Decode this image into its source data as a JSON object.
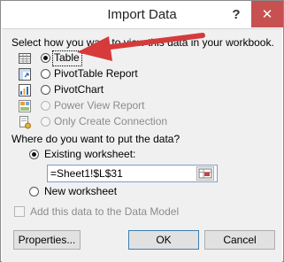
{
  "window": {
    "title": "Import Data",
    "help_glyph": "?",
    "close_glyph": "✕",
    "accent_close": "#c75050"
  },
  "view_section": {
    "heading": "Select how you want to view this data in your workbook.",
    "options": [
      {
        "label": "Table",
        "selected": true,
        "enabled": true
      },
      {
        "label": "PivotTable Report",
        "selected": false,
        "enabled": true
      },
      {
        "label": "PivotChart",
        "selected": false,
        "enabled": true
      },
      {
        "label": "Power View Report",
        "selected": false,
        "enabled": false
      },
      {
        "label": "Only Create Connection",
        "selected": false,
        "enabled": false
      }
    ]
  },
  "location_section": {
    "heading": "Where do you want to put the data?",
    "existing_label": "Existing worksheet:",
    "existing_selected": true,
    "range_value": "=Sheet1!$L$31",
    "new_label": "New worksheet"
  },
  "data_model": {
    "label": "Add this data to the Data Model",
    "enabled": false
  },
  "buttons": {
    "properties": "Properties...",
    "ok": "OK",
    "cancel": "Cancel"
  },
  "annotation": {
    "arrow_color": "#d63a3a"
  }
}
